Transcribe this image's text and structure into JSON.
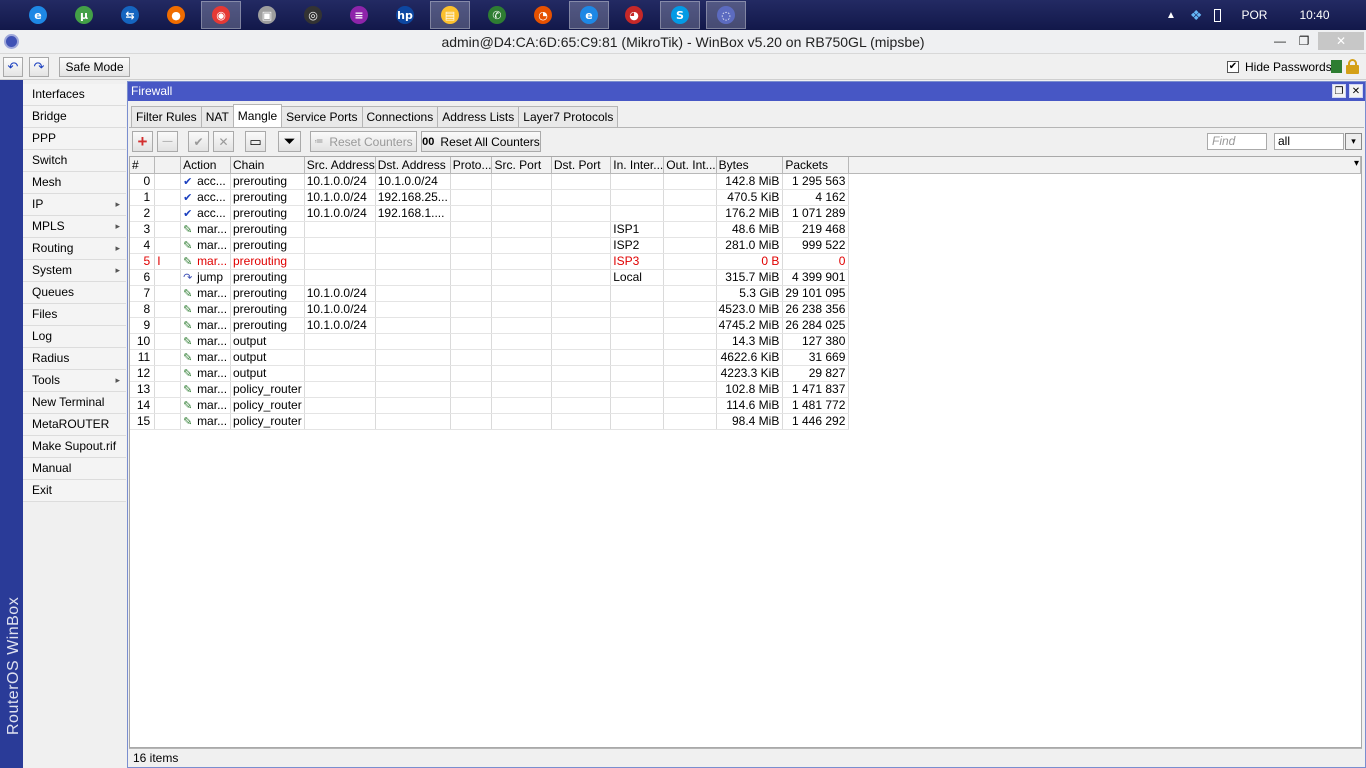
{
  "taskbar": {
    "apps": [
      {
        "name": "ie-icon",
        "glyph": "e",
        "color": "#1e88e5"
      },
      {
        "name": "torrent-icon",
        "glyph": "µ",
        "color": "#43a047"
      },
      {
        "name": "teamviewer-icon",
        "glyph": "⇆",
        "color": "#1565c0"
      },
      {
        "name": "app-orange-icon",
        "glyph": "●",
        "color": "#ef6c00"
      },
      {
        "name": "chrome-icon",
        "glyph": "◉",
        "color": "#e53935"
      },
      {
        "name": "app-gray-icon",
        "glyph": "▣",
        "color": "#9e9e9e"
      },
      {
        "name": "app-dark-icon",
        "glyph": "◎",
        "color": "#333333"
      },
      {
        "name": "app-purple-icon",
        "glyph": "≡",
        "color": "#8e24aa"
      },
      {
        "name": "hp-icon",
        "glyph": "hp",
        "color": "#0d47a1"
      },
      {
        "name": "explorer-icon",
        "glyph": "▤",
        "color": "#fbc02d"
      },
      {
        "name": "whatsapp-icon",
        "glyph": "✆",
        "color": "#2e7d32"
      },
      {
        "name": "app-red-icon",
        "glyph": "◔",
        "color": "#e65100"
      },
      {
        "name": "ie-icon-2",
        "glyph": "e",
        "color": "#1e88e5"
      },
      {
        "name": "app-red2-icon",
        "glyph": "◕",
        "color": "#c62828"
      },
      {
        "name": "skype-icon",
        "glyph": "S",
        "color": "#039be5"
      },
      {
        "name": "winbox-icon",
        "glyph": "◌",
        "color": "#5c6bc0"
      }
    ],
    "language": "POR",
    "clock": "10:40"
  },
  "window": {
    "title": "admin@D4:CA:6D:65:C9:81 (MikroTik) - WinBox v5.20 on RB750GL (mipsbe)",
    "minimize": "—",
    "restore": "❐",
    "close": "✕"
  },
  "toolbar": {
    "undo": "↶",
    "redo": "↷",
    "safe_mode": "Safe Mode",
    "hide_passwords": "Hide Passwords",
    "hide_passwords_check": "✔"
  },
  "brand": "RouterOS WinBox",
  "menu": [
    {
      "label": "Interfaces",
      "sub": ""
    },
    {
      "label": "Bridge",
      "sub": ""
    },
    {
      "label": "PPP",
      "sub": ""
    },
    {
      "label": "Switch",
      "sub": ""
    },
    {
      "label": "Mesh",
      "sub": ""
    },
    {
      "label": "IP",
      "sub": "▸"
    },
    {
      "label": "MPLS",
      "sub": "▸"
    },
    {
      "label": "Routing",
      "sub": "▸"
    },
    {
      "label": "System",
      "sub": "▸"
    },
    {
      "label": "Queues",
      "sub": ""
    },
    {
      "label": "Files",
      "sub": ""
    },
    {
      "label": "Log",
      "sub": ""
    },
    {
      "label": "Radius",
      "sub": ""
    },
    {
      "label": "Tools",
      "sub": "▸"
    },
    {
      "label": "New Terminal",
      "sub": ""
    },
    {
      "label": "MetaROUTER",
      "sub": ""
    },
    {
      "label": "Make Supout.rif",
      "sub": ""
    },
    {
      "label": "Manual",
      "sub": ""
    },
    {
      "label": "Exit",
      "sub": ""
    }
  ],
  "firewall": {
    "title": "Firewall",
    "restore": "❐",
    "close": "✕",
    "tabs": [
      "Filter Rules",
      "NAT",
      "Mangle",
      "Service Ports",
      "Connections",
      "Address Lists",
      "Layer7 Protocols"
    ],
    "active_tab": 2,
    "actions": {
      "add": "+",
      "remove": "—",
      "enable": "✔",
      "disable": "✕",
      "comment": "▭",
      "filter": "⏷",
      "reset_counters": "Reset Counters",
      "reset_all_counters": "Reset All Counters",
      "reset_all_glyph": "00"
    },
    "find_placeholder": "Find",
    "filter_value": "all",
    "filter_arrow": "▾",
    "columns": [
      "#",
      "",
      "Action",
      "Chain",
      "Src. Address",
      "Dst. Address",
      "Proto...",
      "Src. Port",
      "Dst. Port",
      "In. Inter...",
      "Out. Int...",
      "Bytes",
      "Packets"
    ],
    "header_more": "▾",
    "rows": [
      {
        "idx": "0",
        "flag": "",
        "icon": "✔",
        "action": "acc...",
        "chain": "prerouting",
        "src": "10.1.0.0/24",
        "dst": "10.1.0.0/24",
        "proto": "",
        "sport": "",
        "dport": "",
        "inif": "",
        "outif": "",
        "bytes": "142.8 MiB",
        "packets": "1 295 563",
        "disabled": false
      },
      {
        "idx": "1",
        "flag": "",
        "icon": "✔",
        "action": "acc...",
        "chain": "prerouting",
        "src": "10.1.0.0/24",
        "dst": "192.168.25...",
        "proto": "",
        "sport": "",
        "dport": "",
        "inif": "",
        "outif": "",
        "bytes": "470.5 KiB",
        "packets": "4 162",
        "disabled": false
      },
      {
        "idx": "2",
        "flag": "",
        "icon": "✔",
        "action": "acc...",
        "chain": "prerouting",
        "src": "10.1.0.0/24",
        "dst": "192.168.1....",
        "proto": "",
        "sport": "",
        "dport": "",
        "inif": "",
        "outif": "",
        "bytes": "176.2 MiB",
        "packets": "1 071 289",
        "disabled": false
      },
      {
        "idx": "3",
        "flag": "",
        "icon": "✎",
        "action": "mar...",
        "chain": "prerouting",
        "src": "",
        "dst": "",
        "proto": "",
        "sport": "",
        "dport": "",
        "inif": "ISP1",
        "outif": "",
        "bytes": "48.6 MiB",
        "packets": "219 468",
        "disabled": false
      },
      {
        "idx": "4",
        "flag": "",
        "icon": "✎",
        "action": "mar...",
        "chain": "prerouting",
        "src": "",
        "dst": "",
        "proto": "",
        "sport": "",
        "dport": "",
        "inif": "ISP2",
        "outif": "",
        "bytes": "281.0 MiB",
        "packets": "999 522",
        "disabled": false
      },
      {
        "idx": "5",
        "flag": "I",
        "icon": "✎",
        "action": "mar...",
        "chain": "prerouting",
        "src": "",
        "dst": "",
        "proto": "",
        "sport": "",
        "dport": "",
        "inif": "ISP3",
        "outif": "",
        "bytes": "0 B",
        "packets": "0",
        "disabled": true
      },
      {
        "idx": "6",
        "flag": "",
        "icon": "↷",
        "action": "jump",
        "chain": "prerouting",
        "src": "",
        "dst": "",
        "proto": "",
        "sport": "",
        "dport": "",
        "inif": "Local",
        "outif": "",
        "bytes": "315.7 MiB",
        "packets": "4 399 901",
        "disabled": false
      },
      {
        "idx": "7",
        "flag": "",
        "icon": "✎",
        "action": "mar...",
        "chain": "prerouting",
        "src": "10.1.0.0/24",
        "dst": "",
        "proto": "",
        "sport": "",
        "dport": "",
        "inif": "",
        "outif": "",
        "bytes": "5.3 GiB",
        "packets": "29 101 095",
        "disabled": false
      },
      {
        "idx": "8",
        "flag": "",
        "icon": "✎",
        "action": "mar...",
        "chain": "prerouting",
        "src": "10.1.0.0/24",
        "dst": "",
        "proto": "",
        "sport": "",
        "dport": "",
        "inif": "",
        "outif": "",
        "bytes": "4523.0 MiB",
        "packets": "26 238 356",
        "disabled": false
      },
      {
        "idx": "9",
        "flag": "",
        "icon": "✎",
        "action": "mar...",
        "chain": "prerouting",
        "src": "10.1.0.0/24",
        "dst": "",
        "proto": "",
        "sport": "",
        "dport": "",
        "inif": "",
        "outif": "",
        "bytes": "4745.2 MiB",
        "packets": "26 284 025",
        "disabled": false
      },
      {
        "idx": "10",
        "flag": "",
        "icon": "✎",
        "action": "mar...",
        "chain": "output",
        "src": "",
        "dst": "",
        "proto": "",
        "sport": "",
        "dport": "",
        "inif": "",
        "outif": "",
        "bytes": "14.3 MiB",
        "packets": "127 380",
        "disabled": false
      },
      {
        "idx": "11",
        "flag": "",
        "icon": "✎",
        "action": "mar...",
        "chain": "output",
        "src": "",
        "dst": "",
        "proto": "",
        "sport": "",
        "dport": "",
        "inif": "",
        "outif": "",
        "bytes": "4622.6 KiB",
        "packets": "31 669",
        "disabled": false
      },
      {
        "idx": "12",
        "flag": "",
        "icon": "✎",
        "action": "mar...",
        "chain": "output",
        "src": "",
        "dst": "",
        "proto": "",
        "sport": "",
        "dport": "",
        "inif": "",
        "outif": "",
        "bytes": "4223.3 KiB",
        "packets": "29 827",
        "disabled": false
      },
      {
        "idx": "13",
        "flag": "",
        "icon": "✎",
        "action": "mar...",
        "chain": "policy_router",
        "src": "",
        "dst": "",
        "proto": "",
        "sport": "",
        "dport": "",
        "inif": "",
        "outif": "",
        "bytes": "102.8 MiB",
        "packets": "1 471 837",
        "disabled": false
      },
      {
        "idx": "14",
        "flag": "",
        "icon": "✎",
        "action": "mar...",
        "chain": "policy_router",
        "src": "",
        "dst": "",
        "proto": "",
        "sport": "",
        "dport": "",
        "inif": "",
        "outif": "",
        "bytes": "114.6 MiB",
        "packets": "1 481 772",
        "disabled": false
      },
      {
        "idx": "15",
        "flag": "",
        "icon": "✎",
        "action": "mar...",
        "chain": "policy_router",
        "src": "",
        "dst": "",
        "proto": "",
        "sport": "",
        "dport": "",
        "inif": "",
        "outif": "",
        "bytes": "98.4 MiB",
        "packets": "1 446 292",
        "disabled": false
      }
    ],
    "status": "16 items"
  },
  "colors": {
    "brand_strip": "#2a3b98",
    "window_title": "#4757c5",
    "disabled_row": "#e00000",
    "add_red": "#d32f2f",
    "accept_blue": "#1a3fbf",
    "mark_green": "#2e7d32",
    "jump_blue": "#3f51b5",
    "safe_green": "#2e7d32",
    "lock_yellow": "#d4a017"
  }
}
